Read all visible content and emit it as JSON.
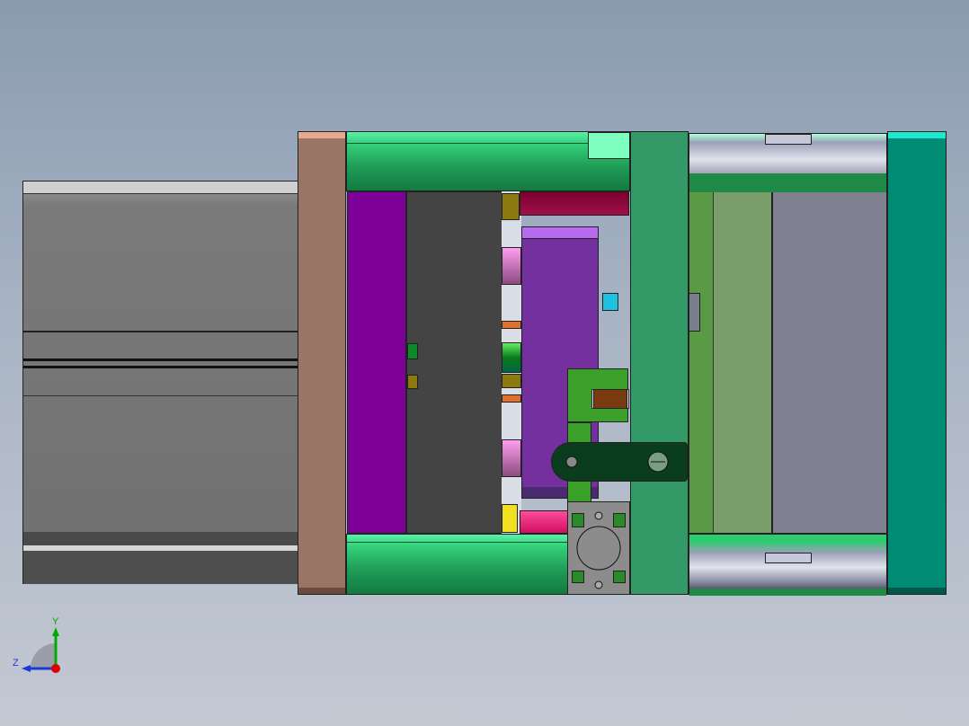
{
  "triad": {
    "y_label": "Y",
    "z_label": "Z"
  },
  "colors": {
    "background_top": "#8a9bb0",
    "background_bottom": "#c3c9d3",
    "cylinder_body": "#7a7a7a",
    "rear_plate": "#9a7565",
    "guide_pillar": "#2ecc71",
    "clamp_plate_purple": "#7d0099",
    "support_dark": "#444444",
    "cavity_purple": "#7530a0",
    "center_plate": "#339966",
    "light_green_plate": "#7a9e6b",
    "grey_block": "#808090",
    "end_plate_teal": "#008b74",
    "axis_y": "#00aa00",
    "axis_z": "#1a3ad6",
    "axis_origin": "#dd0000"
  }
}
